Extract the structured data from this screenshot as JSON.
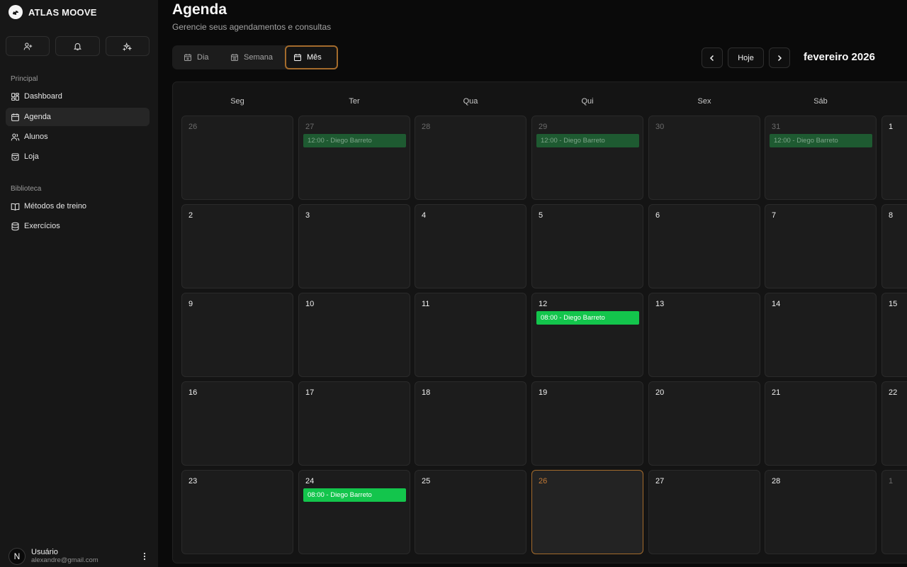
{
  "app": {
    "name": "ATLAS MOOVE"
  },
  "sidebar": {
    "quick_actions": [
      {
        "icon": "user-plus-icon"
      },
      {
        "icon": "bell-icon"
      },
      {
        "icon": "sparkles-icon"
      }
    ],
    "sections": [
      {
        "label": "Principal",
        "items": [
          {
            "label": "Dashboard",
            "icon": "dashboard-icon",
            "active": false
          },
          {
            "label": "Agenda",
            "icon": "calendar-icon",
            "active": true
          },
          {
            "label": "Alunos",
            "icon": "users-icon",
            "active": false
          },
          {
            "label": "Loja",
            "icon": "shopping-bag-icon",
            "active": false
          }
        ]
      },
      {
        "label": "Biblioteca",
        "items": [
          {
            "label": "Métodos de treino",
            "icon": "book-open-icon",
            "active": false
          },
          {
            "label": "Exercícios",
            "icon": "database-icon",
            "active": false
          }
        ]
      }
    ],
    "user": {
      "initial": "N",
      "name": "Usuário",
      "email": "alexandre@gmail.com"
    }
  },
  "header": {
    "title": "Agenda",
    "subtitle": "Gerencie seus agendamentos e consultas"
  },
  "view_tabs": [
    {
      "label": "Dia",
      "icon": "calendar-icon",
      "active": false
    },
    {
      "label": "Semana",
      "icon": "calendar-week-icon",
      "active": false
    },
    {
      "label": "Mês",
      "icon": "calendar-icon",
      "active": true
    }
  ],
  "navigation": {
    "prev": "‹",
    "today": "Hoje",
    "next": "›",
    "month": "fevereiro 2026"
  },
  "calendar": {
    "weekdays": [
      "Seg",
      "Ter",
      "Qua",
      "Qui",
      "Sex",
      "Sáb"
    ],
    "weeks": [
      [
        {
          "day": "26",
          "muted": true
        },
        {
          "day": "27",
          "muted": true,
          "event": "12:00 - Diego Barreto"
        },
        {
          "day": "28",
          "muted": true
        },
        {
          "day": "29",
          "muted": true,
          "event": "12:00 - Diego Barreto"
        },
        {
          "day": "30",
          "muted": true
        },
        {
          "day": "31",
          "muted": true,
          "event": "12:00 - Diego Barreto"
        },
        {
          "day": "1"
        }
      ],
      [
        {
          "day": "2"
        },
        {
          "day": "3"
        },
        {
          "day": "4"
        },
        {
          "day": "5"
        },
        {
          "day": "6"
        },
        {
          "day": "7"
        },
        {
          "day": "8"
        }
      ],
      [
        {
          "day": "9"
        },
        {
          "day": "10"
        },
        {
          "day": "11"
        },
        {
          "day": "12",
          "event": "08:00 - Diego Barreto"
        },
        {
          "day": "13"
        },
        {
          "day": "14"
        },
        {
          "day": "15"
        }
      ],
      [
        {
          "day": "16"
        },
        {
          "day": "17"
        },
        {
          "day": "18"
        },
        {
          "day": "19"
        },
        {
          "day": "20"
        },
        {
          "day": "21"
        },
        {
          "day": "22"
        }
      ],
      [
        {
          "day": "23"
        },
        {
          "day": "24",
          "event": "08:00 - Diego Barreto"
        },
        {
          "day": "25"
        },
        {
          "day": "26",
          "today": true
        },
        {
          "day": "27"
        },
        {
          "day": "28"
        },
        {
          "day": "1",
          "muted": true
        }
      ]
    ]
  },
  "colors": {
    "accent": "#a36b2c",
    "event": "#13c54c",
    "event_muted": "#1e5a31"
  }
}
